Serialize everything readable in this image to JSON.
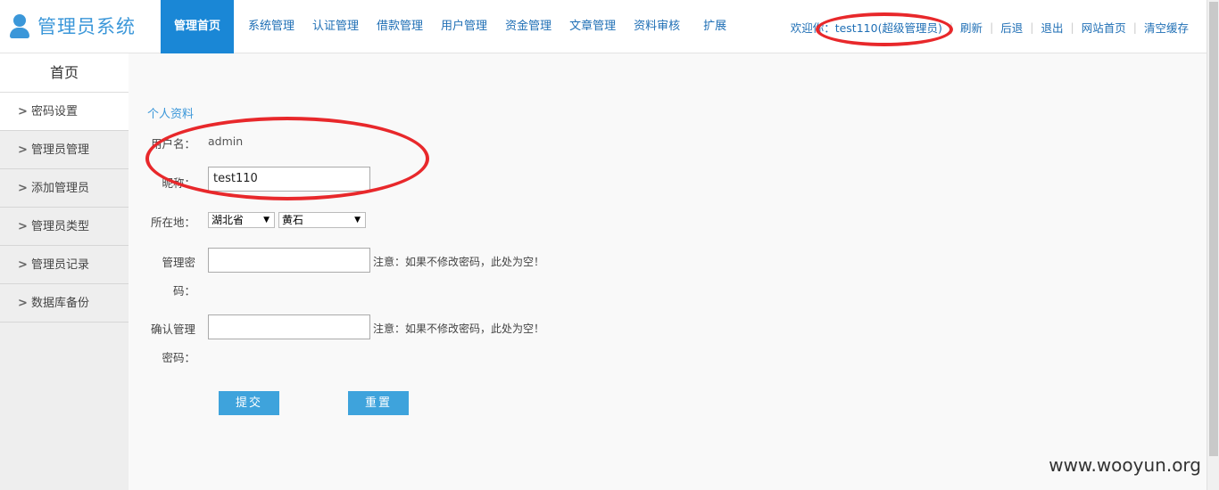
{
  "header": {
    "logo_text": "管理员系统",
    "nav": [
      "管理首页",
      "系统管理",
      "认证管理",
      "借款管理",
      "用户管理",
      "资金管理",
      "文章管理",
      "资料审核",
      "扩展"
    ],
    "welcome": "欢迎你：test110(超级管理员)",
    "links": [
      "刷新",
      "后退",
      "退出",
      "网站首页",
      "清空缓存"
    ]
  },
  "sidebar": {
    "title": "首页",
    "items": [
      "密码设置",
      "管理员管理",
      "添加管理员",
      "管理员类型",
      "管理员记录",
      "数据库备份"
    ]
  },
  "form": {
    "section_title": "个人资料",
    "username_label": "用户名：",
    "username_value": "admin",
    "nickname_label": "昵称：",
    "nickname_value": "test110",
    "location_label": "所在地：",
    "province": "湖北省",
    "city": "黄石",
    "password_label_1": "管理密",
    "password_label_2": "码：",
    "confirm_label_1": "确认管理",
    "confirm_label_2": "密码：",
    "note": "注意：如果不修改密码，此处为空！",
    "submit": "提交",
    "reset": "重置"
  },
  "watermark": "www.wooyun.org",
  "colors": {
    "accent": "#1a87d6",
    "annotation": "#e8282b"
  }
}
